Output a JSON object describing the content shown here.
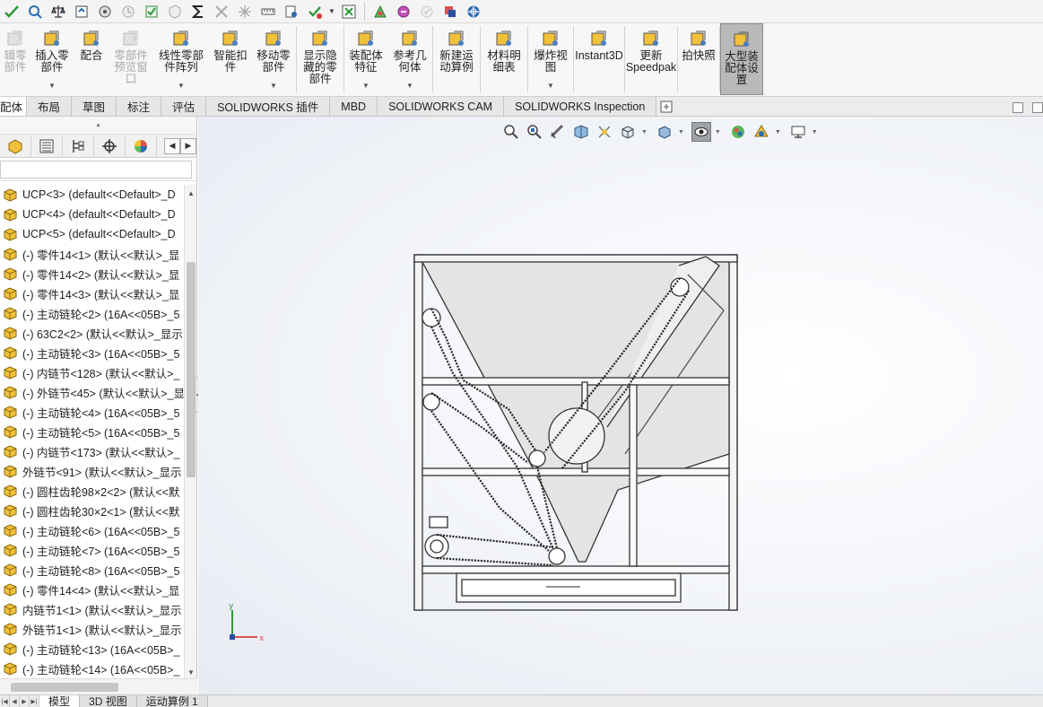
{
  "quickbar": {
    "icons": [
      "spellcheck-icon",
      "zoom-fit-icon",
      "balance-icon",
      "rebuild-icon",
      "options-icon",
      "clock-icon",
      "check-icon",
      "shield-icon",
      "sum-icon",
      "move-icon",
      "explode-icon",
      "measure-icon",
      "pin-icon",
      "grid-x-icon",
      "palette-icon",
      "check-circle-icon",
      "stop-icon",
      "globe-icon"
    ]
  },
  "ribbon": {
    "items": [
      {
        "label": "编辑零部件",
        "short": "辑零\n部件",
        "disabled": true,
        "icon": "edit-component-icon"
      },
      {
        "label": "插入零部件",
        "short": "插入零\n部件",
        "disabled": false,
        "icon": "insert-component-icon",
        "dropdown": true
      },
      {
        "label": "配合",
        "short": "配合",
        "disabled": false,
        "icon": "mate-icon"
      },
      {
        "label": "零部件预览窗口",
        "short": "零部件\n预览窗\n口",
        "disabled": true,
        "icon": "preview-window-icon"
      },
      {
        "label": "线性零部件阵列",
        "short": "线性零部\n件阵列",
        "disabled": false,
        "icon": "linear-pattern-icon",
        "dropdown": true
      },
      {
        "label": "智能扣件",
        "short": "智能扣\n件",
        "disabled": false,
        "icon": "smart-fastener-icon"
      },
      {
        "label": "移动零部件",
        "short": "移动零\n部件",
        "disabled": false,
        "icon": "move-component-icon",
        "dropdown": true
      },
      {
        "label": "显示隐藏的零部件",
        "short": "显示隐\n藏的零\n部件",
        "disabled": false,
        "icon": "show-hidden-icon"
      },
      {
        "label": "装配体特征",
        "short": "装配体\n特征",
        "disabled": false,
        "icon": "assembly-feature-icon",
        "dropdown": true
      },
      {
        "label": "参考几何体",
        "short": "参考几\n何体",
        "disabled": false,
        "icon": "reference-geometry-icon",
        "dropdown": true
      },
      {
        "label": "新建运动算例",
        "short": "新建运\n动算例",
        "disabled": false,
        "icon": "motion-study-icon"
      },
      {
        "label": "材料明细表",
        "short": "材料明\n细表",
        "disabled": false,
        "icon": "bom-icon"
      },
      {
        "label": "爆炸视图",
        "short": "爆炸视\n图",
        "disabled": false,
        "icon": "exploded-view-icon",
        "dropdown": true
      },
      {
        "label": "Instant3D",
        "short": "Instant3D",
        "disabled": false,
        "icon": "instant3d-icon"
      },
      {
        "label": "更新Speedpak",
        "short": "更新\nSpeedpak",
        "disabled": false,
        "icon": "speedpak-icon"
      },
      {
        "label": "拍快照",
        "short": "拍快照",
        "disabled": false,
        "icon": "camera-icon"
      },
      {
        "label": "大型装配体设置",
        "short": "大型装\n配体设\n置",
        "disabled": false,
        "icon": "large-assembly-icon",
        "active": true
      }
    ]
  },
  "tabs": {
    "items": [
      {
        "label": "配体",
        "active": true
      },
      {
        "label": "布局",
        "active": false
      },
      {
        "label": "草图",
        "active": false
      },
      {
        "label": "标注",
        "active": false
      },
      {
        "label": "评估",
        "active": false
      },
      {
        "label": "SOLIDWORKS 插件",
        "active": false
      },
      {
        "label": "MBD",
        "active": false
      },
      {
        "label": "SOLIDWORKS CAM",
        "active": false
      },
      {
        "label": "SOLIDWORKS Inspection",
        "active": false
      }
    ]
  },
  "tree": {
    "items": [
      "UCP<3> (default<<Default>_D",
      "UCP<4> (default<<Default>_D",
      "UCP<5> (default<<Default>_D",
      "(-) 零件14<1> (默认<<默认>_显",
      "(-) 零件14<2> (默认<<默认>_显",
      "(-) 零件14<3> (默认<<默认>_显",
      "(-) 主动链轮<2> (16A<<05B>_5",
      "(-) 63C2<2> (默认<<默认>_显示",
      "(-) 主动链轮<3> (16A<<05B>_5",
      "(-) 内链节<128> (默认<<默认>_",
      "(-) 外链节<45> (默认<<默认>_显",
      "(-) 主动链轮<4> (16A<<05B>_5",
      "(-) 主动链轮<5> (16A<<05B>_5",
      "(-) 内链节<173> (默认<<默认>_",
      "外链节<91> (默认<<默认>_显示",
      "(-) 圆柱齿轮98×2<2> (默认<<默",
      "(-) 圆柱齿轮30×2<1> (默认<<默",
      "(-) 主动链轮<6> (16A<<05B>_5",
      "(-) 主动链轮<7> (16A<<05B>_5",
      "(-) 主动链轮<8> (16A<<05B>_5",
      "(-) 零件14<4> (默认<<默认>_显",
      "内链节1<1> (默认<<默认>_显示",
      "外链节1<1> (默认<<默认>_显示",
      "(-) 主动链轮<13> (16A<<05B>_",
      "(-) 主动链轮<14> (16A<<05B>_"
    ]
  },
  "viewport": {
    "triad": {
      "x_label": "x",
      "y_label": "y"
    }
  },
  "bottom_tabs": {
    "items": [
      {
        "label": "模型",
        "active": true
      },
      {
        "label": "3D 视图",
        "active": false
      },
      {
        "label": "运动算例 1",
        "active": false
      }
    ]
  },
  "colors": {
    "component_icon": "#f2c13a",
    "active_ribbon": "#b9b9b9"
  }
}
